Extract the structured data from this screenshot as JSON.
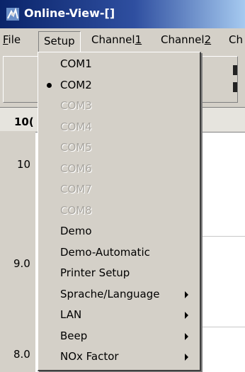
{
  "window": {
    "title": "Online-View-[]",
    "icon": "app-icon"
  },
  "menubar": {
    "file": {
      "prefix": "",
      "underline": "F",
      "suffix": "ile"
    },
    "setup": {
      "prefix": "Setup",
      "underline": "",
      "suffix": ""
    },
    "channel1": {
      "prefix": "Channel",
      "underline": "1",
      "suffix": ""
    },
    "channel2": {
      "prefix": "Channel",
      "underline": "2",
      "suffix": ""
    },
    "channel3": {
      "prefix": "Ch",
      "underline": "",
      "suffix": ""
    }
  },
  "chart": {
    "y_labels": [
      "10(",
      "10",
      "9.0",
      "8.0"
    ]
  },
  "dropdown": {
    "items": [
      {
        "label": "COM1",
        "enabled": true,
        "checked": false,
        "submenu": false
      },
      {
        "label": "COM2",
        "enabled": true,
        "checked": true,
        "submenu": false
      },
      {
        "label": "COM3",
        "enabled": false,
        "checked": false,
        "submenu": false
      },
      {
        "label": "COM4",
        "enabled": false,
        "checked": false,
        "submenu": false
      },
      {
        "label": "COM5",
        "enabled": false,
        "checked": false,
        "submenu": false
      },
      {
        "label": "COM6",
        "enabled": false,
        "checked": false,
        "submenu": false
      },
      {
        "label": "COM7",
        "enabled": false,
        "checked": false,
        "submenu": false
      },
      {
        "label": "COM8",
        "enabled": false,
        "checked": false,
        "submenu": false
      },
      {
        "label": "Demo",
        "enabled": true,
        "checked": false,
        "submenu": false
      },
      {
        "label": "Demo-Automatic",
        "enabled": true,
        "checked": false,
        "submenu": false
      },
      {
        "label": "Printer Setup",
        "enabled": true,
        "checked": false,
        "submenu": false
      },
      {
        "label": "Sprache/Language",
        "enabled": true,
        "checked": false,
        "submenu": true
      },
      {
        "label": "LAN",
        "enabled": true,
        "checked": false,
        "submenu": true
      },
      {
        "label": "Beep",
        "enabled": true,
        "checked": false,
        "submenu": true
      },
      {
        "label": "NOx Factor",
        "enabled": true,
        "checked": false,
        "submenu": true
      }
    ]
  },
  "colors": {
    "titlebar_start": "#0a246a",
    "titlebar_end": "#a6caf0",
    "face": "#d4d0c8",
    "disabled_text": "#a9a6a0"
  }
}
